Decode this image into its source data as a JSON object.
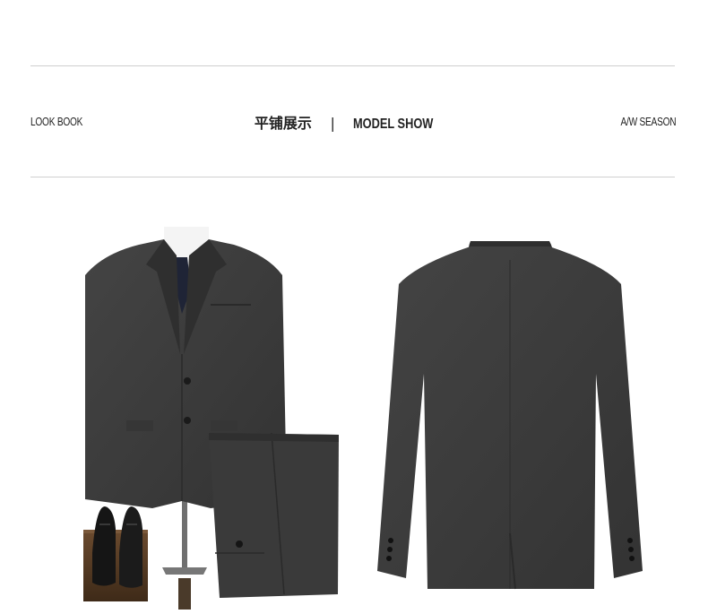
{
  "header": {
    "left_tag": "LOOK BOOK",
    "center_cn": "平铺展示",
    "separator": "|",
    "center_en": "MODEL SHOW",
    "right_tag": "A/W SEASON"
  },
  "colors": {
    "suit": "#3b3b3b",
    "suit_dark": "#2a2a2a",
    "tie": "#1f2436",
    "shirt": "#f4f4f4",
    "rule": "#cfcfcf"
  }
}
